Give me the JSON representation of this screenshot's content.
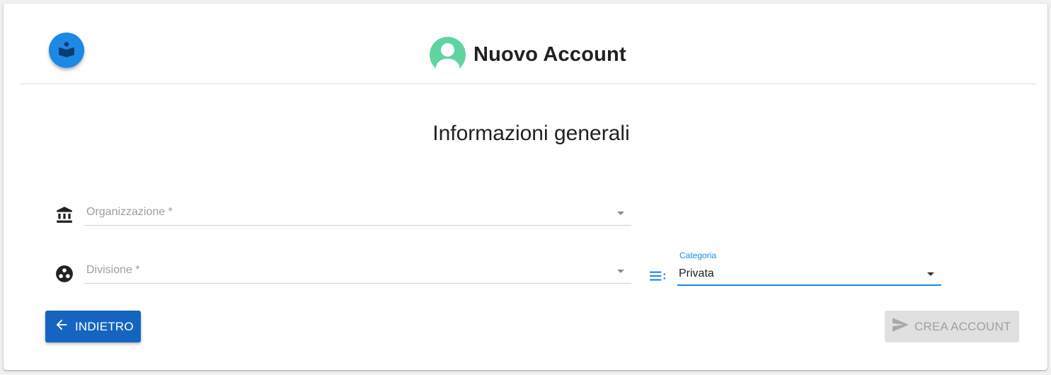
{
  "header": {
    "title": "Nuovo Account",
    "app_icon": "book-reader-icon",
    "avatar_icon": "account-circle-icon"
  },
  "section": {
    "title": "Informazioni generali"
  },
  "form": {
    "organizzazione": {
      "placeholder": "Organizzazione *",
      "icon": "bank-icon"
    },
    "divisione": {
      "placeholder": "Divisione *",
      "icon": "group-work-icon"
    },
    "categoria": {
      "label": "Categoria",
      "value": "Privata",
      "icon": "list-icon"
    }
  },
  "actions": {
    "back_label": "INDIETRO",
    "create_label": "CREA ACCOUNT"
  },
  "colors": {
    "primary": "#1e88e5",
    "back_button": "#1565c0",
    "avatar": "#5fd49f",
    "disabled": "#e0e0e0"
  }
}
